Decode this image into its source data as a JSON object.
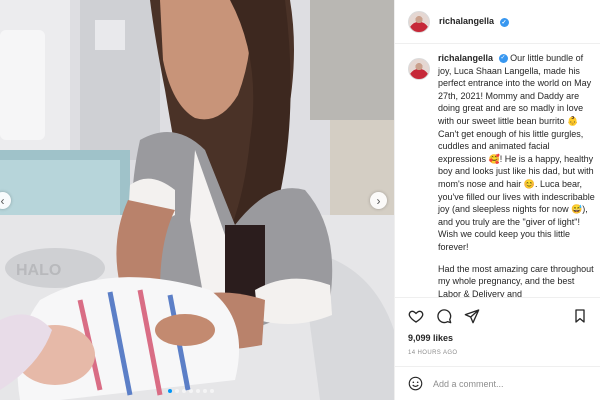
{
  "post": {
    "username": "richalangella",
    "verified_badge": "✓",
    "accent": "#0095f6",
    "slides": 7,
    "current_slide": 1
  },
  "caption": {
    "username": "richalangella",
    "verified_badge": "✓",
    "part1": "Our little bundle of joy, Luca Shaan Langella, made his perfect entrance into the world on May 27th, 2021! Mommy and Daddy are doing great and are so madly in love with our sweet little bean burrito ",
    "emoji1": "👶",
    "part2": " Can't get enough of his little gurgles, cuddles and animated facial expressions ",
    "emoji2": "🥰",
    "part3": "! He is a happy, healthy boy and looks just like his dad, but with mom's nose and hair ",
    "emoji3": "😊",
    "part4": ". Luca bear, you've filled our lives with indescribable joy (and sleepless nights for now ",
    "emoji4": "😅",
    "part5": "), and you truly are the \"giver of light\"! Wish we could keep you this little forever!",
    "paragraph2": "Had the most amazing care throughout my whole pregnancy, and the best Labor & Delivery and"
  },
  "stats": {
    "likes": "9,099 likes",
    "timestamp": "14 HOURS AGO"
  },
  "comment": {
    "placeholder": "Add a comment..."
  },
  "icons": {
    "prev": "chevron-left-icon",
    "next": "chevron-right-icon",
    "like": "heart-icon",
    "comment": "comment-icon",
    "share": "paper-plane-icon",
    "save": "bookmark-icon",
    "emoji": "smiley-icon"
  }
}
